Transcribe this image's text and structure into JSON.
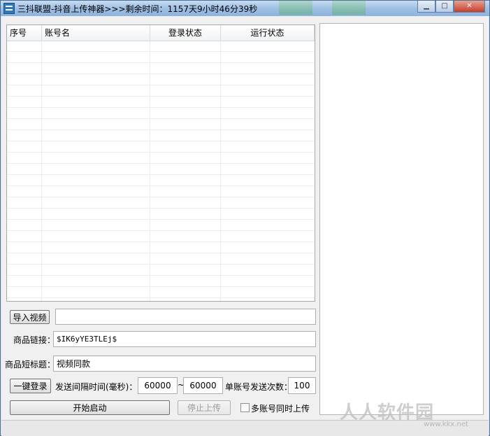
{
  "window": {
    "title": "三抖联盟-抖音上传神器>>>剩余时间：1157天9小时46分39秒",
    "controls": {
      "minimize": "▁",
      "maximize": "□",
      "close": "✕"
    }
  },
  "accounts_table": {
    "columns": [
      "序号",
      "账号名",
      "登录状态",
      "运行状态"
    ],
    "rows": []
  },
  "form": {
    "import_video_button": "导入视频",
    "import_video_path": "",
    "product_link_label": "商品链接：",
    "product_link_value": "$IK6yYE3TLEj$",
    "product_title_label": "商品短标题：",
    "product_title_value": "视频同款",
    "login_button": "一键登录",
    "interval_label": "发送间隔时间(毫秒)：",
    "interval_min": "60000",
    "interval_sep": "~",
    "interval_max": "60000",
    "send_count_label": "单账号发送次数：",
    "send_count_value": "100",
    "start_button": "开始启动",
    "stop_button": "停止上传",
    "multi_upload_label": "多账号同时上传",
    "multi_upload_checked": false
  },
  "watermark": {
    "text": "人人软件园",
    "sub": "www.kkx.net"
  }
}
